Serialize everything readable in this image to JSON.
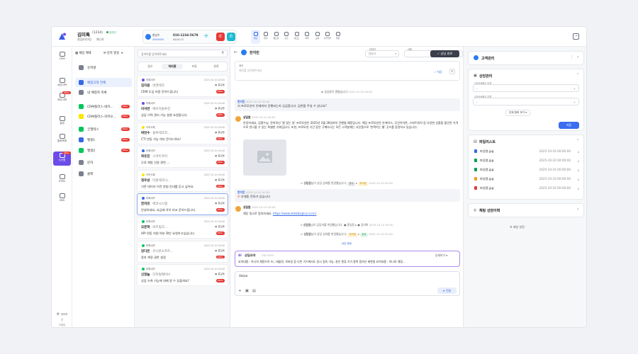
{
  "header": {
    "customer_name": "김미톡",
    "customer_id": "(1234)",
    "online_label": "온라인",
    "sub_info": "영업본부3팀",
    "sub_role": "매니저",
    "call_label": "현상수",
    "call_sub": "00000000",
    "call_number": "010-1234-5678",
    "call_timer": "00:00:15",
    "tools": [
      "채팅",
      "문자",
      "헤드셋",
      "출근",
      "레코드",
      "회의",
      "교육",
      "사무업무",
      "행정"
    ]
  },
  "rail": [
    {
      "label": "CRM",
      "badge": ""
    },
    {
      "label": "상담이력",
      "badge": ""
    },
    {
      "label": "처리이력",
      "badge": "999+"
    },
    {
      "label": "일정",
      "badge": ""
    },
    {
      "label": "통화목록",
      "badge": ""
    },
    {
      "label": "수신함",
      "badge": "999+"
    },
    {
      "label": "조직도",
      "badge": ""
    },
    {
      "label": "SMS",
      "badge": ""
    }
  ],
  "rail_bottom": {
    "settings": "관리자",
    "help": "도움말"
  },
  "channels": {
    "tab1": "채팅 예제",
    "tab2": "문자 발송",
    "items": [
      {
        "label": "유저명",
        "badge": "",
        "color": "#7b8190"
      },
      {
        "label": "예정고객 전체",
        "badge": "",
        "color": "#3668e5"
      },
      {
        "label": "내 예정자 목록",
        "badge": "",
        "color": "#7b8190"
      },
      {
        "label": "CRM플러스-네이...",
        "badge": "999+",
        "color": "#03c75a"
      },
      {
        "label": "CRM플러스-카카오...",
        "badge": "999+",
        "color": "#fee500"
      },
      {
        "label": "굿챗테스",
        "badge": "999+",
        "color": "#03c75a"
      },
      {
        "label": "밸생1",
        "badge": "999+",
        "color": "#3668e5"
      },
      {
        "label": "밸생2",
        "badge": "999+",
        "color": "#03c75a"
      },
      {
        "label": "문자",
        "badge": "",
        "color": "#7b8190"
      },
      {
        "label": "콜백",
        "badge": "",
        "color": "#7b8190"
      }
    ]
  },
  "list": {
    "search_placeholder": "검색어를 입력해주세요",
    "tabs": [
      "접수",
      "처리중",
      "보류",
      "완료"
    ],
    "active_tab": "처리중",
    "cards": [
      {
        "source": "마톡비즈",
        "dot": "#6c4ce8",
        "name": "김지원",
        "company": "· 비엔테크",
        "msg": "CRM 도입 비용 문의드립니다",
        "time": "2025.10.10 00:00",
        "agent": "홍길동",
        "badge": "999+"
      },
      {
        "source": "마톡비즈",
        "dot": "#6c4ce8",
        "name": "이서연",
        "company": "· 에이치솔루션",
        "msg": "상담 이력 관리 기능 설명 요청합니다.",
        "time": "2025.10.10 00:00",
        "agent": "홍길동",
        "badge": "999+"
      },
      {
        "source": "카카오톡",
        "dot": "#fee500",
        "name": "박민수",
        "company": "· 블루테크코...",
        "msg": "CTI 연동 가능 여부 문의드려요!",
        "time": "2025.10.10 00:00",
        "agent": "홍길동",
        "badge": "999+"
      },
      {
        "source": "마톡비즈",
        "dot": "#3668e5",
        "name": "최유진",
        "company": "· 스마트코어",
        "msg": "무료 체험 신청 관련 ...",
        "time": "2025.10.10 00:00",
        "agent": "홍길동",
        "badge": "999+"
      },
      {
        "source": "카카오톡",
        "dot": "#fee500",
        "name": "정우성",
        "company": "· 더원테크니...",
        "msg": "기존 데이터 이전 방법 안내를 듣고 싶어요.",
        "time": "2025.10.10 00:00",
        "agent": "홍길동",
        "badge": "999+"
      },
      {
        "source": "마톡비즈",
        "dot": "#3668e5",
        "name": "한지민",
        "company": "· 에코시스템",
        "msg": "안녕하세요, 요금제 차이 비교 문의드립니다.",
        "time": "2025.10.10 00:00",
        "agent": "홍길동",
        "badge": "999+"
      },
      {
        "source": "마톡비즈",
        "dot": "#03c75a",
        "name": "오준혁",
        "company": "· 비즈링크...",
        "msg": "API 연동 지원 여부 확인 요청하고싶습니다",
        "time": "2025.10.10 00:00",
        "agent": "홍길동",
        "badge": "999+"
      },
      {
        "source": "마톡비즈",
        "dot": "#03c75a",
        "name": "강다은",
        "company": "· 유니온소프트...",
        "msg": "용자 계정 권한 설정",
        "time": "2025.10.10 00:00",
        "agent": "홍길동",
        "badge": "999+"
      },
      {
        "source": "마톡비즈",
        "dot": "#03c75a",
        "name": "신정늘",
        "company": "· 디지털웨이브",
        "msg": "상담 녹취 기능에 대해 알 수 있을까요?",
        "time": "2025.10.10 00:00",
        "agent": "홍길동",
        "badge": "999+"
      }
    ]
  },
  "chat": {
    "title": "한지민",
    "filter1_label": "담당자",
    "filter1_value": "담당자",
    "filter2_label": "상태",
    "filter2_value": "",
    "memo_placeholder": "메모 입력",
    "done_button": "상담 완료",
    "note_label": "메모",
    "note_placeholder": "메모를 입력해주세요",
    "save_label": "저장",
    "opened": "상담창이 열렸습니다",
    "opened_time": "2025.10.10 00:00",
    "m1_name": "한지민",
    "m1_time": "2025.10.10 00:00",
    "m1_text": "저 프로모션이 언제까지 진행되는지 궁금합니다. 답변을 주실 수 있나요?",
    "a1_name": "상담원",
    "a1_time": "2025.10.10 00:00",
    "a1_text": "안녕하세요, 김철수님. 문의하신 '봄 맞는 달' 프로모션은 2025년 2월 28일까지 진행될 예정입니다. 해당 프로모션은 온케이스, 무선이어폰, 스마트워치 등 다양한 상품을 할인된 가격으로 만나볼 수 있는 특별한 기회입니다. 또한, 프로모션 기간 동안 구매하시는 모든 고객분께는 사은품으로 '반짝이는 별' 굿즈를 증정하고 있습니다.",
    "s1_pre": "상담원",
    "s1_mid": "님이 상담 상태를 변경했습니다.",
    "s1_from": "접수",
    "s1_to": "처리중",
    "s1_time": "2025.10.10 00:00",
    "m2_name": "한지민",
    "m2_time": "2025.10.10 00:00",
    "m2_text": "부재중 전화가 있습니다",
    "a2_name": "상담원",
    "a2_time": "2025.10.10 00:00",
    "a2_text": "해당 링크로 접속하세요.",
    "a2_link": "https://www.atalkbizplus.co.kr/",
    "s2_pre": "상담원",
    "s2_mid": "님이 담당자를 변경했습니다.",
    "s2_from": "홍길동",
    "s2_to": "김미톡",
    "s2_time": "2025.10.10 00:00",
    "s3_pre": "상담원",
    "s3_mid": "님이 상담 상태를 변경했습니다.",
    "s3_from": "처리중",
    "s3_to": "완료",
    "s3_time": "2025.10.10 00:00",
    "end_label": "상담 종료",
    "ai_label": "AI",
    "ai_title": "상담요약",
    "ai_time": "오후 00:00",
    "ai_detail": "상세보기",
    "ai_text": "요약내용 : 하나의 계정으로 PC, 태블릿, 모바일 등 다른 기기에서도 동시 접속 가능, 같은 종류 기기 중복 접속은 제한됨 요약내용 : 하나의 계정...",
    "input_value": "Value",
    "send_label": "전송"
  },
  "right": {
    "crm_title": "고객관리",
    "counsel_title": "상담관리",
    "field1_label": "1차상세필드 분류",
    "field1_value": "-",
    "field2_label": "2차상세필드 분류",
    "field2_value": "-",
    "view_all": "전체 항목 보기",
    "save": "저장",
    "files_title": "파일리스트",
    "files": [
      {
        "name": "파일명.jpg",
        "date": "2025-10-10 00:00:00",
        "color": "#3668e5"
      },
      {
        "name": "파일명.jpg",
        "date": "2025-10-10 00:00:00",
        "color": "#03a04f"
      },
      {
        "name": "파일명.jpg",
        "date": "2025-10-10 00:00:00",
        "color": "#03a04f"
      },
      {
        "name": "파일명.jpg",
        "date": "2025-10-10 00:00:00",
        "color": "#f29c1f"
      },
      {
        "name": "파일명.jpg",
        "date": "2025-10-10 00:00:00",
        "color": "#e53935"
      }
    ],
    "history_title": "채팅 상담이력",
    "panel_settings": "패널 설정"
  }
}
